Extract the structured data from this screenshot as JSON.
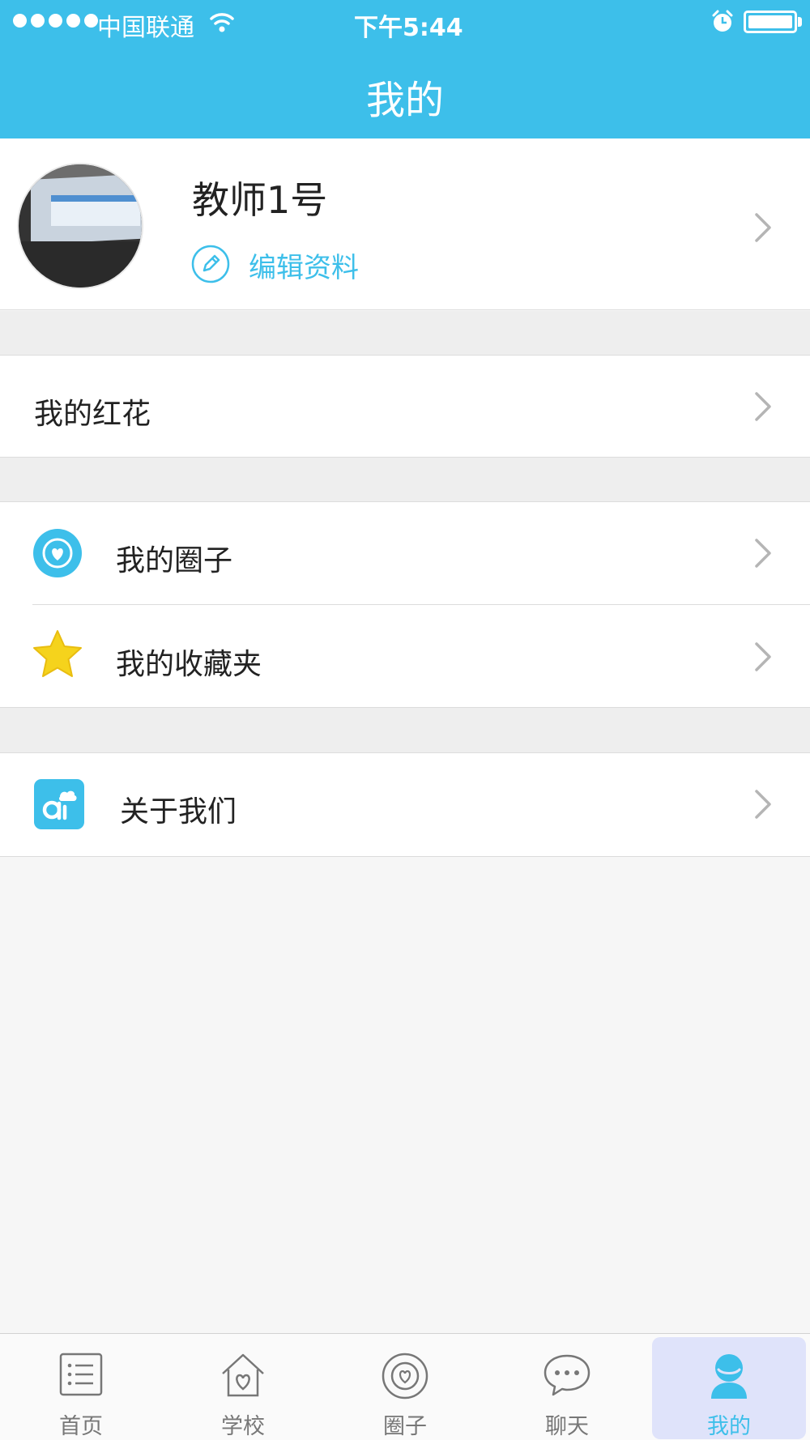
{
  "status_bar": {
    "carrier": "中国联通",
    "time": "下午5:44"
  },
  "header": {
    "title": "我的"
  },
  "profile": {
    "name": "教师1号",
    "edit_label": "编辑资料"
  },
  "menu": {
    "red_flowers": "我的红花",
    "my_circle": "我的圈子",
    "favorites": "我的收藏夹",
    "about_us": "关于我们"
  },
  "tabbar": {
    "items": [
      {
        "label": "首页",
        "icon": "list-icon"
      },
      {
        "label": "学校",
        "icon": "school-house-icon"
      },
      {
        "label": "圈子",
        "icon": "circle-heart-icon"
      },
      {
        "label": "聊天",
        "icon": "chat-bubble-icon"
      },
      {
        "label": "我的",
        "icon": "user-icon"
      }
    ],
    "active_index": 4
  },
  "colors": {
    "brand": "#3dbfea",
    "star": "#f5d31c",
    "active_tab_bg": "#dfe3fa"
  }
}
